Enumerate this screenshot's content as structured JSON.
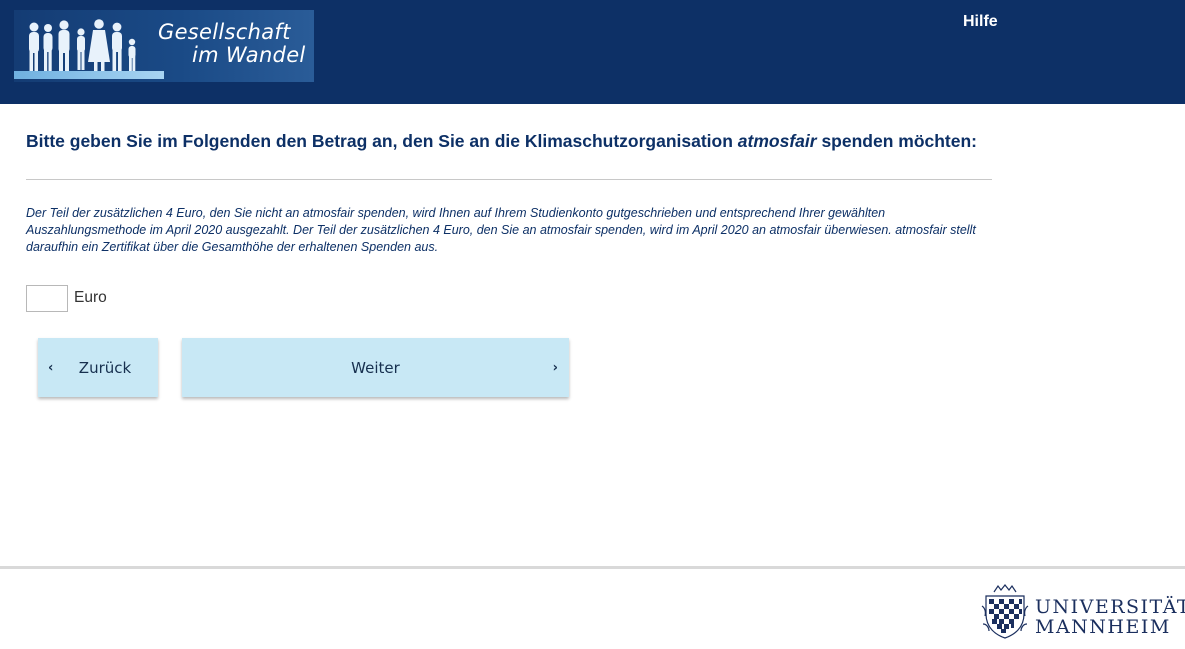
{
  "header": {
    "logo": {
      "line1": "Gesellschaft",
      "line2": "im Wandel"
    },
    "help_label": "Hilfe"
  },
  "question": {
    "prefix": "Bitte geben Sie im Folgenden den Betrag an, den Sie an die Klimaschutzorganisation ",
    "emphasis": "atmosfair",
    "suffix": " spenden möchten:"
  },
  "info_text": "Der Teil der zusätzlichen 4 Euro, den Sie nicht an atmosfair spenden, wird Ihnen auf Ihrem Studienkonto gutgeschrieben und entsprechend Ihrer gewählten Auszahlungsmethode im April 2020 ausgezahlt. Der Teil der zusätzlichen 4 Euro, den Sie an atmosfair spenden, wird im April 2020 an atmosfair überwiesen. atmosfair stellt daraufhin ein Zertifikat über die Gesamthöhe der erhaltenen Spenden aus.",
  "amount": {
    "value": "",
    "unit": "Euro"
  },
  "nav": {
    "back_label": "Zurück",
    "next_label": "Weiter",
    "back_icon": "chevron-left-icon",
    "next_icon": "chevron-right-icon"
  },
  "footer": {
    "university_line1": "UNIVERSITÄT",
    "university_line2": "MANNHEIM"
  },
  "colors": {
    "header_bg": "#0d3066",
    "question_text": "#0d3066",
    "button_bg": "#c8e8f5"
  }
}
